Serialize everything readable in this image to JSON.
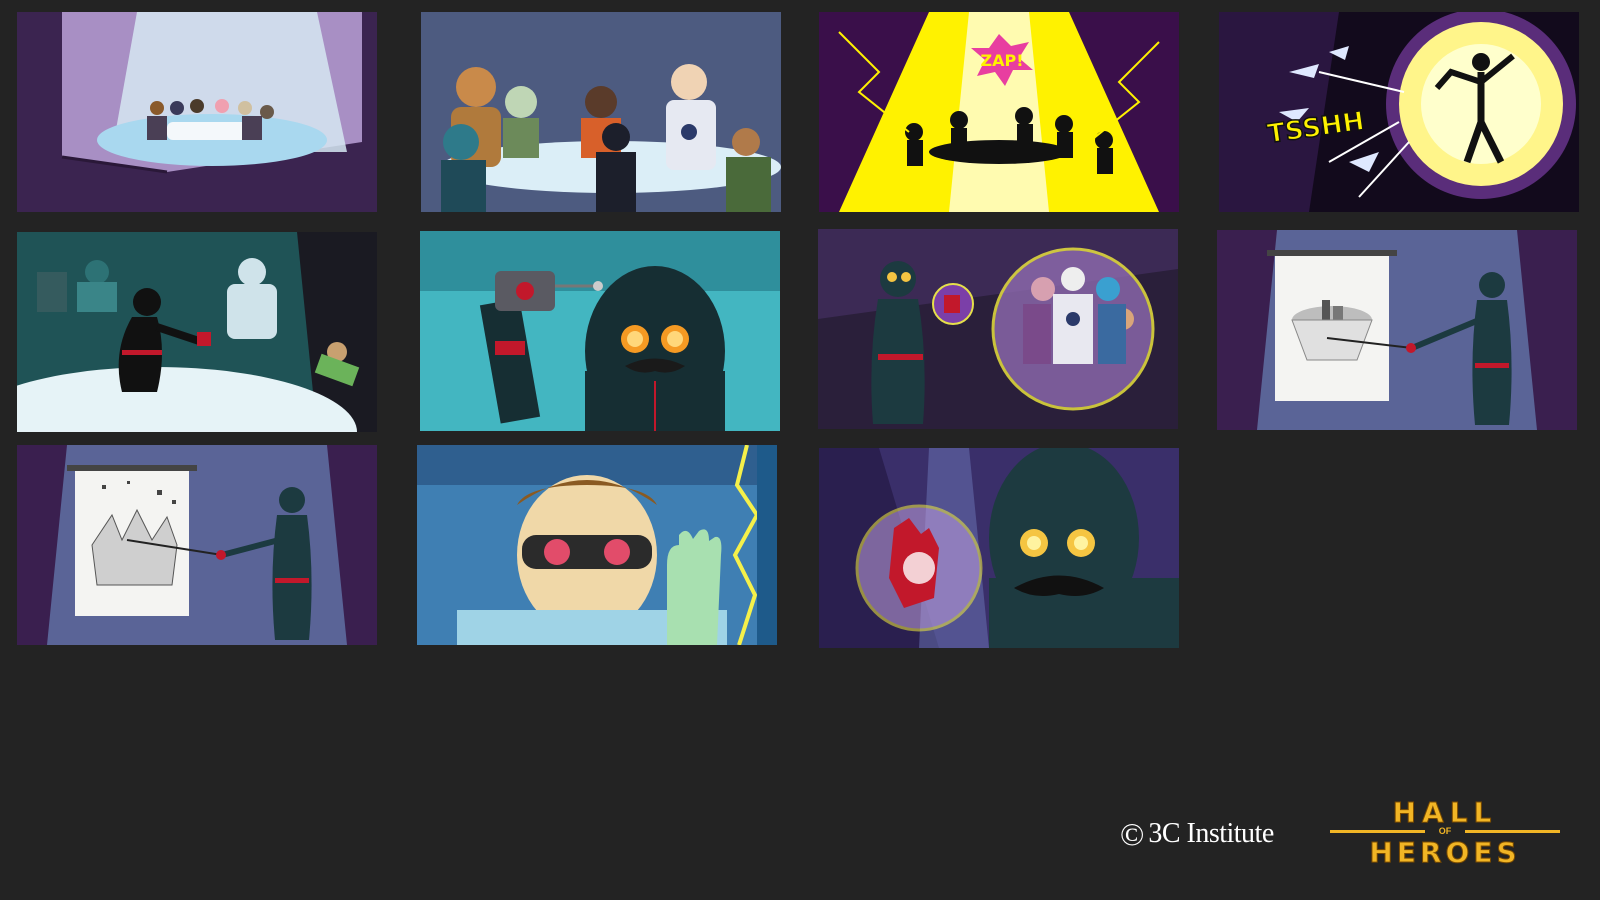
{
  "storyboard": {
    "panels": [
      {
        "id": "p1",
        "sound_effect": ""
      },
      {
        "id": "p2",
        "sound_effect": ""
      },
      {
        "id": "p3",
        "sound_effect": "ZAP!"
      },
      {
        "id": "p4",
        "sound_effect": "TSSHH"
      },
      {
        "id": "p5",
        "sound_effect": ""
      },
      {
        "id": "p6",
        "sound_effect": ""
      },
      {
        "id": "p7",
        "sound_effect": ""
      },
      {
        "id": "p8",
        "sound_effect": ""
      },
      {
        "id": "p9",
        "sound_effect": ""
      },
      {
        "id": "p10",
        "sound_effect": ""
      },
      {
        "id": "p11",
        "sound_effect": ""
      }
    ]
  },
  "footer": {
    "institute_symbol": "©",
    "institute_name": "3C Institute",
    "game_logo": {
      "line1": "HALL",
      "line2": "OF",
      "line3": "HEROES"
    }
  },
  "colors": {
    "background": "#232323",
    "purple": "#4a2a6b",
    "teal": "#2b6f73",
    "yellow": "#fff200",
    "logo_gold": "#f1b525"
  }
}
